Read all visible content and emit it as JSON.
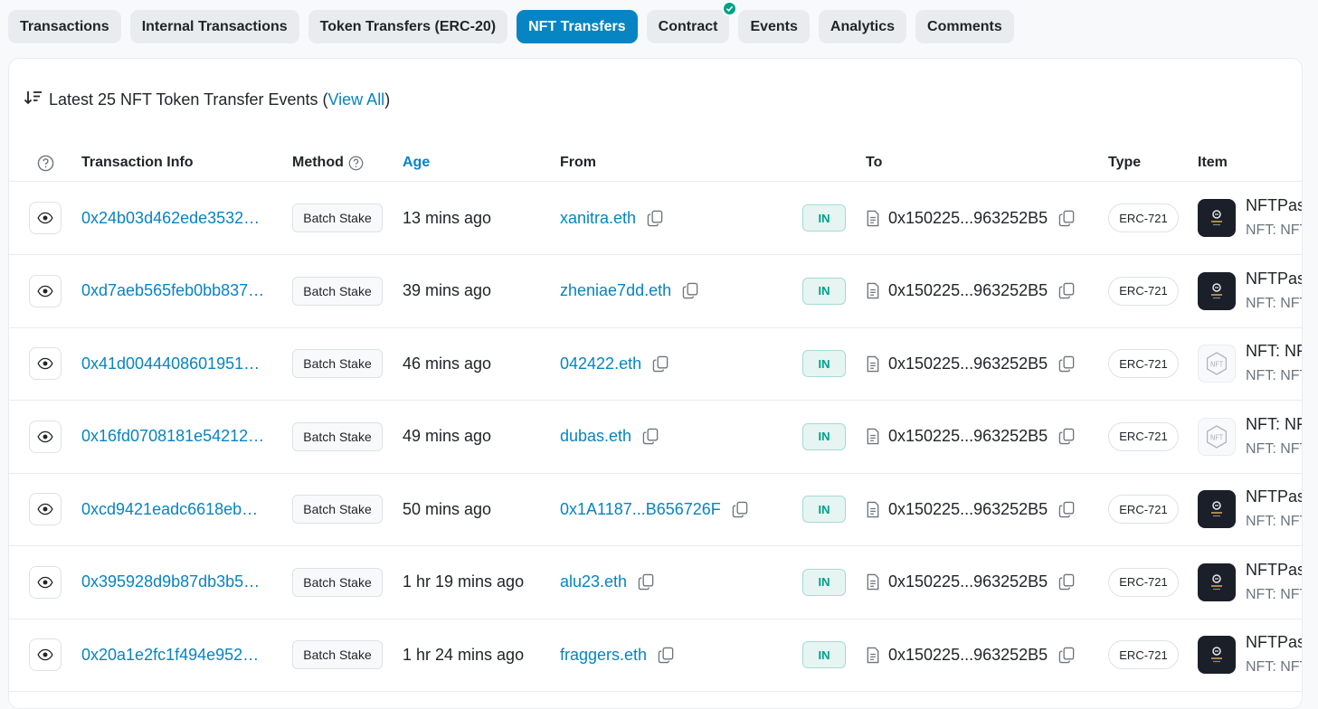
{
  "tabs": [
    {
      "label": "Transactions",
      "active": false
    },
    {
      "label": "Internal Transactions",
      "active": false
    },
    {
      "label": "Token Transfers (ERC-20)",
      "active": false
    },
    {
      "label": "NFT Transfers",
      "active": true
    },
    {
      "label": "Contract",
      "active": false,
      "verified": true
    },
    {
      "label": "Events",
      "active": false
    },
    {
      "label": "Analytics",
      "active": false
    },
    {
      "label": "Comments",
      "active": false
    }
  ],
  "card": {
    "title_prefix": "Latest 25 NFT Token Transfer Events (",
    "view_all": "View All",
    "title_suffix": ")"
  },
  "headers": {
    "transaction_info": "Transaction Info",
    "method": "Method",
    "age": "Age",
    "from": "From",
    "to": "To",
    "type": "Type",
    "item": "Item"
  },
  "rows": [
    {
      "hash": "0x24b03d462ede3532…",
      "method": "Batch Stake",
      "age": "13 mins ago",
      "from": "xanitra.eth",
      "direction": "IN",
      "to": "0x150225...963252B5",
      "type": "ERC-721",
      "item_image": "dark",
      "item_name": "NFTPass",
      "item_sub": "NFT: NFTPass"
    },
    {
      "hash": "0xd7aeb565feb0bb837…",
      "method": "Batch Stake",
      "age": "39 mins ago",
      "from": "zheniae7dd.eth",
      "direction": "IN",
      "to": "0x150225...963252B5",
      "type": "ERC-721",
      "item_image": "dark",
      "item_name": "NFTPass",
      "item_sub": "NFT: NFTPass"
    },
    {
      "hash": "0x41d0044408601951…",
      "method": "Batch Stake",
      "age": "46 mins ago",
      "from": "042422.eth",
      "direction": "IN",
      "to": "0x150225...963252B5",
      "type": "ERC-721",
      "item_image": "placeholder",
      "item_name": "NFT: NFTPass",
      "item_sub": "NFT: NFTPass"
    },
    {
      "hash": "0x16fd0708181e54212…",
      "method": "Batch Stake",
      "age": "49 mins ago",
      "from": "dubas.eth",
      "direction": "IN",
      "to": "0x150225...963252B5",
      "type": "ERC-721",
      "item_image": "placeholder",
      "item_name": "NFT: NFTPass",
      "item_sub": "NFT: NFTPass"
    },
    {
      "hash": "0xcd9421eadc6618eb…",
      "method": "Batch Stake",
      "age": "50 mins ago",
      "from": "0x1A1187...B656726F",
      "direction": "IN",
      "to": "0x150225...963252B5",
      "type": "ERC-721",
      "item_image": "dark",
      "item_name": "NFTPass",
      "item_sub": "NFT: NFTPass"
    },
    {
      "hash": "0x395928d9b87db3b5…",
      "method": "Batch Stake",
      "age": "1 hr 19 mins ago",
      "from": "alu23.eth",
      "direction": "IN",
      "to": "0x150225...963252B5",
      "type": "ERC-721",
      "item_image": "dark",
      "item_name": "NFTPass",
      "item_sub": "NFT: NFTPass"
    },
    {
      "hash": "0x20a1e2fc1f494e952…",
      "method": "Batch Stake",
      "age": "1 hr 24 mins ago",
      "from": "fraggers.eth",
      "direction": "IN",
      "to": "0x150225...963252B5",
      "type": "ERC-721",
      "item_image": "dark",
      "item_name": "NFTPass",
      "item_sub": "NFT: NFTPass"
    }
  ]
}
